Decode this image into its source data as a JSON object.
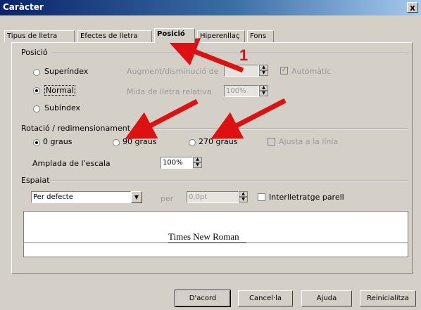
{
  "window": {
    "title": "Caràcter",
    "close_label": "x"
  },
  "tabs": [
    {
      "label": "Tipus de lletra"
    },
    {
      "label": "Efectes de lletra"
    },
    {
      "label": "Posició",
      "active": true
    },
    {
      "label": "Hiperenllaç"
    },
    {
      "label": "Fons"
    }
  ],
  "position_section": {
    "title": "Posició",
    "options": [
      {
        "label": "Superíndex",
        "selected": false
      },
      {
        "label": "Normal",
        "selected": true
      },
      {
        "label": "Subíndex",
        "selected": false
      }
    ],
    "raise_lower_label": "Augment/disminució de",
    "raise_lower_value": "",
    "automatic_label": "Automàtic",
    "relative_size_label": "Mida de lletra relativa",
    "relative_size_value": "100%"
  },
  "rotation_section": {
    "title": "Rotació / redimensionament",
    "options": [
      {
        "label": "0 graus",
        "selected": true
      },
      {
        "label": "90 graus",
        "selected": false
      },
      {
        "label": "270 graus",
        "selected": false
      }
    ],
    "fit_line_label": "Ajusta a la línia",
    "scale_width_label": "Amplada de l'escala",
    "scale_width_value": "100%"
  },
  "spacing_section": {
    "title": "Espaiat",
    "select_value": "Per defecte",
    "by_label": "per",
    "by_value": "0,0pt",
    "pair_kerning_label": "Interlletratge parell"
  },
  "preview": {
    "font_name": "Times New Roman"
  },
  "annotation": {
    "marker": "1",
    "color": "#dd1111"
  },
  "buttons": {
    "ok": "D'acord",
    "cancel": "Cancel·la",
    "help": "Ajuda",
    "reset": "Reinicialitza"
  }
}
